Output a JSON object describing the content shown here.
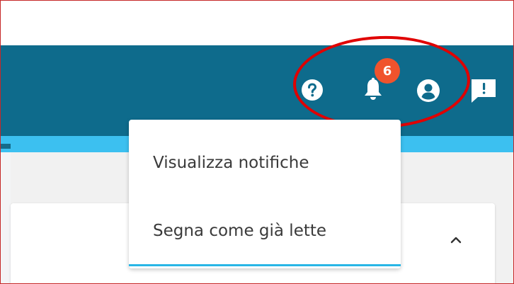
{
  "header": {
    "icons": [
      {
        "name": "help-icon"
      },
      {
        "name": "bell-icon"
      },
      {
        "name": "account-icon"
      },
      {
        "name": "chat-icon"
      }
    ],
    "notification_count": "6"
  },
  "notifications_menu": {
    "items": [
      {
        "label": "Visualizza notifiche"
      },
      {
        "label": "Segna come già lette"
      }
    ]
  },
  "colors": {
    "nav_bar": "#0e6b8c",
    "accent_strip": "#3cc0f0",
    "badge": "#f0532d",
    "annotation": "#e00000",
    "menu_underline": "#29b6e6"
  }
}
